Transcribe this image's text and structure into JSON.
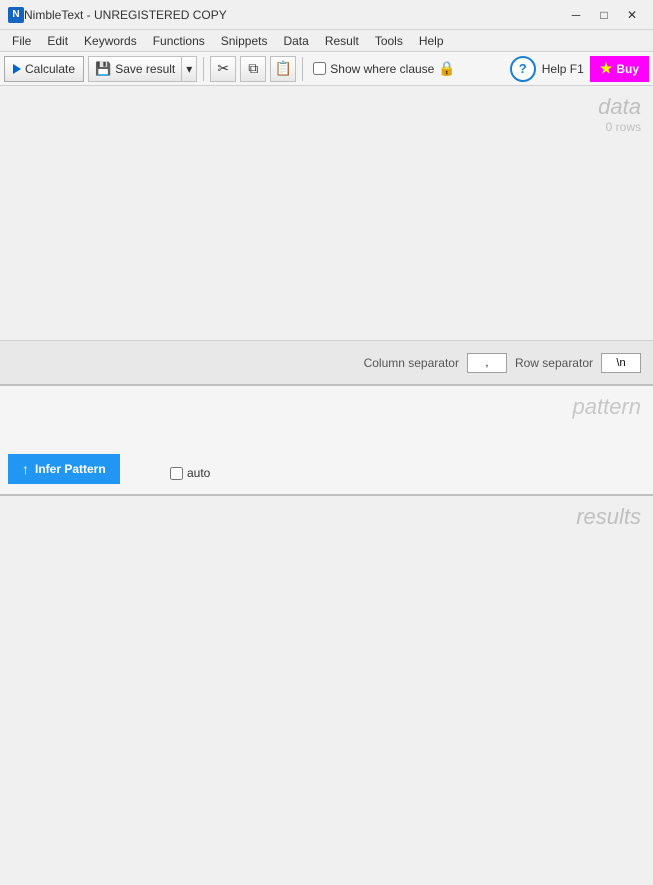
{
  "titleBar": {
    "appName": "NimbleText - UNREGISTERED COPY",
    "minBtn": "─",
    "maxBtn": "□",
    "closeBtn": "✕"
  },
  "menuBar": {
    "items": [
      "File",
      "Edit",
      "Keywords",
      "Functions",
      "Snippets",
      "Data",
      "Result",
      "Tools",
      "Help"
    ]
  },
  "toolbar": {
    "calculateLabel": "Calculate",
    "saveResultLabel": "Save result",
    "whereClauseLabel": "Show where clause",
    "helpLabel": "Help",
    "f1Label": "F1",
    "buyLabel": "Buy",
    "cutTooltip": "Cut",
    "copyTooltip": "Copy",
    "pasteTooltip": "Paste"
  },
  "data": {
    "sectionLabel": "data",
    "rowsLabel": "0 rows",
    "columnSeparatorLabel": "Column separator",
    "columnSeparatorValue": ",",
    "rowSeparatorLabel": "Row separator",
    "rowSeparatorValue": "\\n"
  },
  "pattern": {
    "sectionLabel": "pattern",
    "inferPatternLabel": "Infer Pattern",
    "autoLabel": "auto"
  },
  "results": {
    "sectionLabel": "results"
  }
}
